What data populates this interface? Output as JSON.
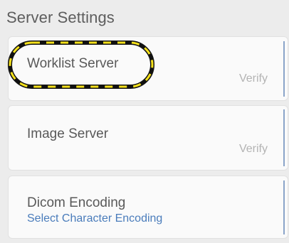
{
  "header": {
    "title": "Server Settings"
  },
  "cards": {
    "worklist": {
      "title": "Worklist Server",
      "action": "Verify"
    },
    "image": {
      "title": "Image Server",
      "action": "Verify"
    },
    "dicom": {
      "title": "Dicom Encoding",
      "subtitle": "Select Character Encoding"
    }
  },
  "colors": {
    "background": "#ececec",
    "card": "#fafafa",
    "link": "#4a7cbb",
    "highlight_dash": "#f5e11c",
    "highlight_outline": "#111111"
  }
}
